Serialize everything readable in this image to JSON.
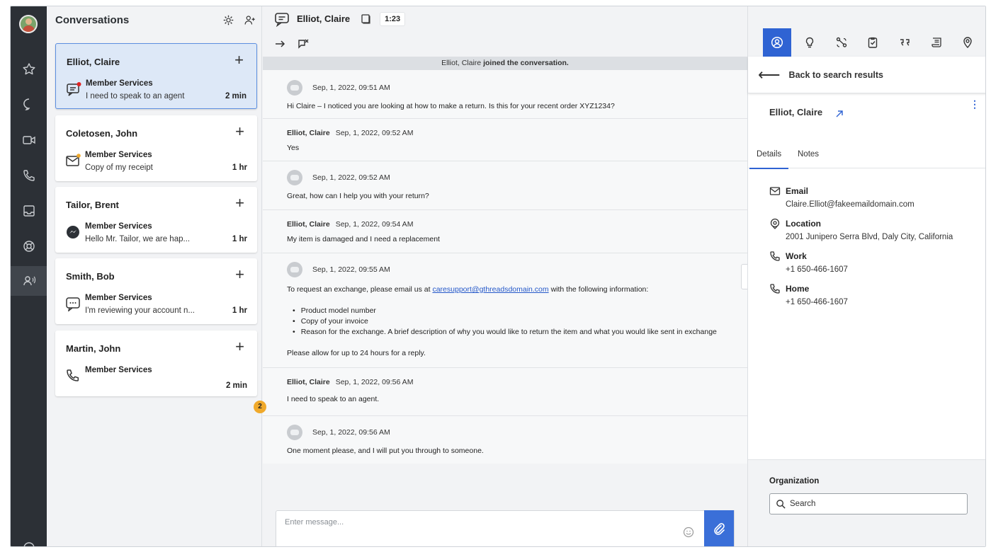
{
  "header": {
    "conversations_title": "Conversations",
    "contact_name": "Elliot, Claire",
    "timer": "1:23"
  },
  "conversations": [
    {
      "name": "Elliot, Claire",
      "queue": "Member Services",
      "snippet": "I need to speak to an agent",
      "time": "2 min",
      "channel": "chat-icon"
    },
    {
      "name": "Coletosen, John",
      "queue": "Member Services",
      "snippet": "Copy of my receipt",
      "time": "1 hr",
      "channel": "email-icon"
    },
    {
      "name": "Tailor, Brent",
      "queue": "Member Services",
      "snippet": "Hello Mr. Tailor, we are hap...",
      "time": "1 hr",
      "channel": "messenger-icon"
    },
    {
      "name": "Smith, Bob",
      "queue": "Member Services",
      "snippet": "I'm reviewing your account n...",
      "time": "1 hr",
      "channel": "sms-icon"
    },
    {
      "name": "Martin, John",
      "queue": "Member Services",
      "snippet": "",
      "time": "2 min",
      "channel": "phone-icon"
    }
  ],
  "chat": {
    "banner_name": "Elliot, Claire",
    "banner_text": "joined the conversation.",
    "messages": [
      {
        "sender": "",
        "time": "Sep, 1, 2022, 09:51 AM",
        "text": "Hi Claire – I noticed you are looking at how to make a return. Is this for your recent order XYZ1234?"
      },
      {
        "sender": "Elliot, Claire",
        "time": "Sep, 1, 2022, 09:52 AM",
        "text": "Yes"
      },
      {
        "sender": "",
        "time": "Sep, 1, 2022, 09:52 AM",
        "text": "Great, how can I help you with your return?"
      },
      {
        "sender": "Elliot, Claire",
        "time": "Sep, 1, 2022, 09:54 AM",
        "text": "My item is damaged and I need a replacement"
      },
      {
        "sender": "",
        "time": "Sep, 1, 2022, 09:55 AM",
        "text_before": "To request an exchange, please email us at",
        "link": "caresupport@gthreadsdomain.com",
        "text_after": "with the following information:",
        "bullets": [
          "Product model number",
          "Copy of your invoice",
          "Reason for the exchange. A brief description of why you would like to return the item and what you would like sent in exchange"
        ],
        "footer": "Please allow for up to 24 hours for a reply."
      },
      {
        "sender": "Elliot, Claire",
        "time": "Sep, 1, 2022, 09:56 AM",
        "text": "I need to speak to an agent."
      },
      {
        "sender": "",
        "time": "Sep, 1, 2022, 09:56 AM",
        "text": "One moment please, and I will put you through to someone."
      }
    ],
    "unread_badge": "2",
    "input_placeholder": "Enter message..."
  },
  "right_panel": {
    "back_label": "Back to search results",
    "profile_name": "Elliot, Claire",
    "tabs": [
      "Details",
      "Notes"
    ],
    "fields": [
      {
        "label": "Email",
        "value": "Claire.Elliot@fakeemaildomain.com",
        "icon": "email-icon"
      },
      {
        "label": "Location",
        "value": "2001 Junipero Serra Blvd, Daly City, California",
        "icon": "location-icon"
      },
      {
        "label": "Work",
        "value": "+1 650-466-1607",
        "icon": "phone-icon"
      },
      {
        "label": "Home",
        "value": "+1 650-466-1607",
        "icon": "phone-icon"
      }
    ],
    "organization_label": "Organization",
    "organization_search": "Search"
  },
  "colors": {
    "accent": "#2f63d3",
    "rail": "#2c3036",
    "badge": "#f0a92b",
    "notify_dot": "#e02424"
  }
}
